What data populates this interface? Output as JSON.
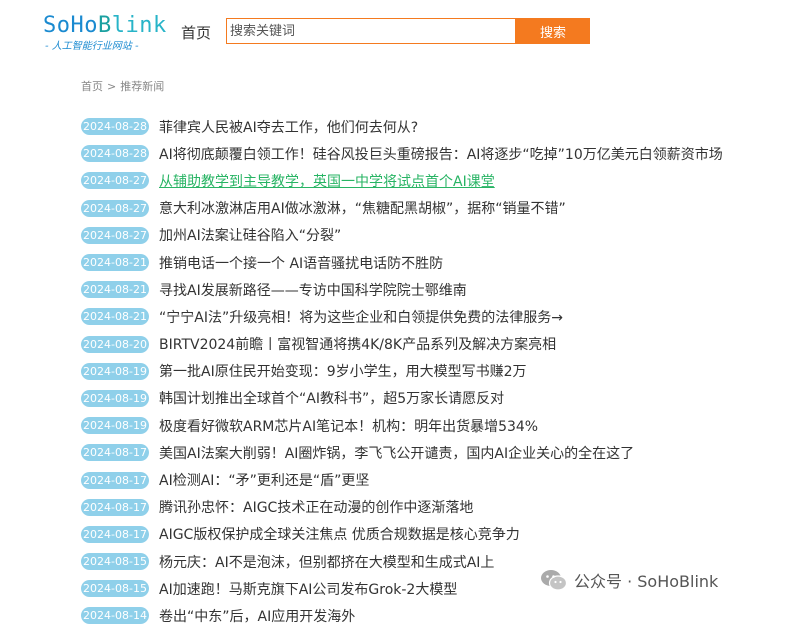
{
  "logo": {
    "parts": [
      "So",
      "Ho",
      "B",
      "link"
    ],
    "tagline": "- 人工智能行业网站 -"
  },
  "nav": {
    "home": "首页"
  },
  "search": {
    "placeholder": "搜索关键词",
    "button": "搜索"
  },
  "breadcrumb": {
    "home": "首页",
    "separator": ">",
    "current": "推荐新闻"
  },
  "news": [
    {
      "date": "2024-08-28",
      "title": "菲律宾人民被AI夺去工作，他们何去何从?"
    },
    {
      "date": "2024-08-28",
      "title": "AI将彻底颠覆白领工作！硅谷风投巨头重磅报告：AI将逐步“吃掉”10万亿美元白领薪资市场"
    },
    {
      "date": "2024-08-27",
      "title": "从辅助教学到主导教学，英国一中学将试点首个AI课堂"
    },
    {
      "date": "2024-08-27",
      "title": "意大利冰激淋店用AI做冰激淋，“焦糖配黑胡椒”，据称“销量不错”"
    },
    {
      "date": "2024-08-27",
      "title": "加州AI法案让硅谷陷入“分裂”"
    },
    {
      "date": "2024-08-21",
      "title": "推销电话一个接一个 AI语音骚扰电话防不胜防"
    },
    {
      "date": "2024-08-21",
      "title": "寻找AI发展新路径——专访中国科学院院士鄂维南"
    },
    {
      "date": "2024-08-21",
      "title": "“宁宁AI法”升级亮相！将为这些企业和白领提供免费的法律服务→"
    },
    {
      "date": "2024-08-20",
      "title": "BIRTV2024前瞻丨富视智通将携4K/8K产品系列及解决方案亮相"
    },
    {
      "date": "2024-08-19",
      "title": "第一批AI原住民开始变现：9岁小学生，用大模型写书赚2万"
    },
    {
      "date": "2024-08-19",
      "title": "韩国计划推出全球首个“AI教科书”，超5万家长请愿反对"
    },
    {
      "date": "2024-08-19",
      "title": "极度看好微软ARM芯片AI笔记本！机构：明年出货暴增534%"
    },
    {
      "date": "2024-08-17",
      "title": "美国AI法案大削弱！AI圈炸锅，李飞飞公开谴责，国内AI企业关心的全在这了"
    },
    {
      "date": "2024-08-17",
      "title": "AI检测AI：“矛”更利还是“盾”更坚"
    },
    {
      "date": "2024-08-17",
      "title": "腾讯孙忠怀：AIGC技术正在动漫的创作中逐渐落地"
    },
    {
      "date": "2024-08-17",
      "title": "AIGC版权保护成全球关注焦点 优质合规数据是核心竞争力"
    },
    {
      "date": "2024-08-15",
      "title": "杨元庆：AI不是泡沫，但别都挤在大模型和生成式AI上"
    },
    {
      "date": "2024-08-15",
      "title": "AI加速跑！马斯克旗下AI公司发布Grok-2大模型"
    },
    {
      "date": "2024-08-14",
      "title": "卷出“中东”后，AI应用开发海外"
    }
  ],
  "active_index": 2,
  "watermark": {
    "text": "公众号 · SoHoBlink"
  },
  "colors": {
    "accent": "#f47a1f",
    "badge": "#8fd0ea",
    "link_active": "#28b464",
    "logo_blue": "#1a8ad0"
  }
}
